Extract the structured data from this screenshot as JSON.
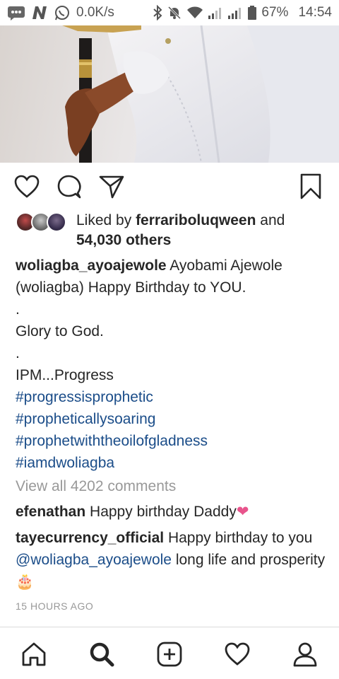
{
  "status_bar": {
    "speed": "0.0K/s",
    "battery": "67%",
    "time": "14:54"
  },
  "post": {
    "likes": {
      "prefix": "Liked by",
      "first_user": "ferrariboluqween",
      "conjunction": "and",
      "others": "54,030 others"
    },
    "caption": {
      "username": "woliagba_ayoajewole",
      "line1": "Ayobami Ajewole",
      "line2": "(woliagba) Happy Birthday to YOU.",
      "dot1": ".",
      "line3": "Glory to God.",
      "dot2": ".",
      "line4": "IPM...Progress",
      "hashtags": [
        "#progressisprophetic",
        "#propheticallysoaring",
        "#prophetwiththeoilofgladness",
        "#iamdwoliagba"
      ]
    },
    "view_all_comments": "View all 4202 comments",
    "comments": [
      {
        "username": "efenathan",
        "text": "Happy birthday Daddy",
        "emoji": "❤"
      },
      {
        "username": "tayecurrency_official",
        "text_before": "Happy birthday to you",
        "mention": "@woliagba_ayoajewole",
        "text_after": "long life and prosperity",
        "emoji": "🎂"
      }
    ],
    "timestamp": "15 HOURS AGO"
  },
  "colors": {
    "hashtag": "#1b4d89",
    "muted": "#999999",
    "heart_pink": "#e8548c"
  },
  "icons": {
    "actions": [
      "heart-icon",
      "comment-icon",
      "share-icon",
      "bookmark-icon"
    ],
    "nav": [
      "home-icon",
      "search-icon",
      "new-post-icon",
      "activity-icon",
      "profile-icon"
    ]
  }
}
